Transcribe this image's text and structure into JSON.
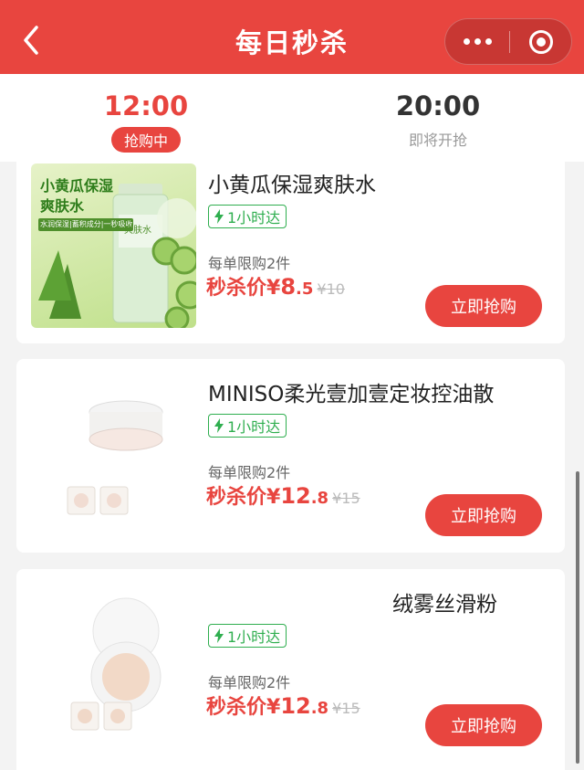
{
  "nav": {
    "title": "每日秒杀",
    "back_icon": "chevron-left-icon",
    "more_icon": "more-dots-icon",
    "close_icon": "target-ring-icon",
    "bar_color": "#e8453f"
  },
  "tabs": [
    {
      "time": "12:00",
      "status": "抢购中",
      "active": true
    },
    {
      "time": "20:00",
      "status": "即将开抢",
      "active": false
    }
  ],
  "products": [
    {
      "name": "小黄瓜保湿爽肤水",
      "image_title": "小黄瓜保湿爽肤水",
      "image_sub": "水润保湿|蓄积成分|一秒吸收",
      "image_bottle_text": "爽肤水",
      "delivery_badge": "1小时达",
      "limit": "每单限购2件",
      "price_label": "秒杀价¥",
      "price_int": "8",
      "price_dec": ".5",
      "price_orig": "¥10",
      "button": "立即抢购"
    },
    {
      "name": "MINISO柔光壹加壹定妆控油散",
      "delivery_badge": "1小时达",
      "limit": "每单限购2件",
      "price_label": "秒杀价¥",
      "price_int": "12",
      "price_dec": ".8",
      "price_orig": "¥15",
      "button": "立即抢购"
    },
    {
      "name": "绒雾丝滑粉",
      "delivery_badge": "1小时达",
      "limit": "每单限购2件",
      "price_label": "秒杀价¥",
      "price_int": "12",
      "price_dec": ".8",
      "price_orig": "¥15",
      "button": "立即抢购"
    }
  ],
  "colors": {
    "accent": "#e8453f",
    "badge_green": "#2fae4f"
  }
}
